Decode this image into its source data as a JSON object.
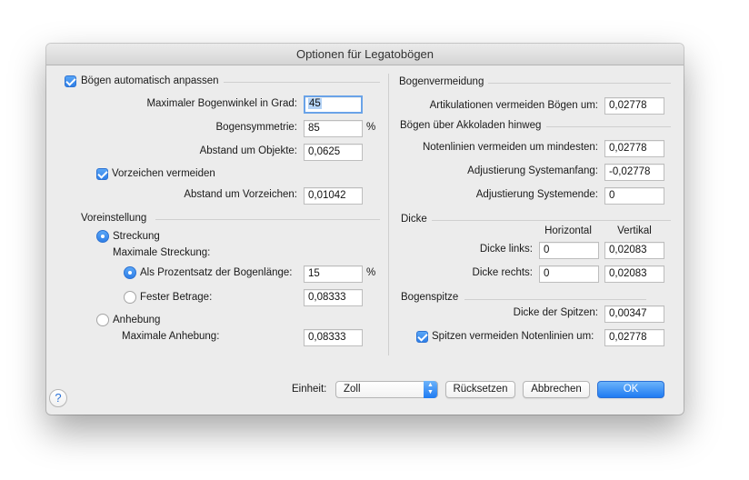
{
  "window": {
    "title": "Optionen für Legatobögen"
  },
  "left": {
    "auto_adjust": {
      "label": "Bögen automatisch anpassen",
      "checked": true
    },
    "max_angle": {
      "label": "Maximaler Bogenwinkel in Grad:",
      "value": "45"
    },
    "symmetry": {
      "label": "Bogensymmetrie:",
      "value": "85",
      "unit": "%"
    },
    "object_distance": {
      "label": "Abstand um Objekte:",
      "value": "0,0625"
    },
    "avoid_accidentals": {
      "label": "Vorzeichen vermeiden",
      "checked": true
    },
    "accidental_distance": {
      "label": "Abstand um Vorzeichen:",
      "value": "0,01042"
    },
    "preset": {
      "heading": "Voreinstellung",
      "stretch": {
        "label": "Streckung",
        "selected": true
      },
      "max_stretch_label": "Maximale Streckung:",
      "percent": {
        "label": "Als Prozentsatz der Bogenlänge:",
        "value": "15",
        "unit": "%",
        "selected": true
      },
      "fixed": {
        "label": "Fester Betrage:",
        "value": "0,08333",
        "selected": false
      },
      "lift": {
        "label": "Anhebung",
        "selected": false
      },
      "max_lift": {
        "label": "Maximale Anhebung:",
        "value": "0,08333"
      }
    }
  },
  "right": {
    "avoid": {
      "heading": "Bogenvermeidung",
      "articulations": {
        "label": "Artikulationen vermeiden Bögen um:",
        "value": "0,02778"
      }
    },
    "across_systems": {
      "heading": "Bögen über Akkoladen hinweg",
      "staff_lines": {
        "label": "Notenlinien vermeiden um mindesten:",
        "value": "0,02778"
      },
      "system_start": {
        "label": "Adjustierung Systemanfang:",
        "value": "-0,02778"
      },
      "system_end": {
        "label": "Adjustierung Systemende:",
        "value": "0"
      }
    },
    "thickness": {
      "heading": "Dicke",
      "col_horizontal": "Horizontal",
      "col_vertical": "Vertikal",
      "left": {
        "label": "Dicke links:",
        "h": "0",
        "v": "0,02083"
      },
      "right": {
        "label": "Dicke rechts:",
        "h": "0",
        "v": "0,02083"
      }
    },
    "tip": {
      "heading": "Bogenspitze",
      "tip_thickness": {
        "label": "Dicke der Spitzen:",
        "value": "0,00347"
      },
      "avoid_staff": {
        "label": "Spitzen vermeiden Notenlinien um:",
        "value": "0,02778",
        "checked": true
      }
    }
  },
  "footer": {
    "help": "?",
    "unit_label": "Einheit:",
    "unit_value": "Zoll",
    "reset": "Rücksetzen",
    "cancel": "Abbrechen",
    "ok": "OK"
  },
  "colors": {
    "accent": "#2f7fe7",
    "dialog_bg": "#ececec"
  }
}
